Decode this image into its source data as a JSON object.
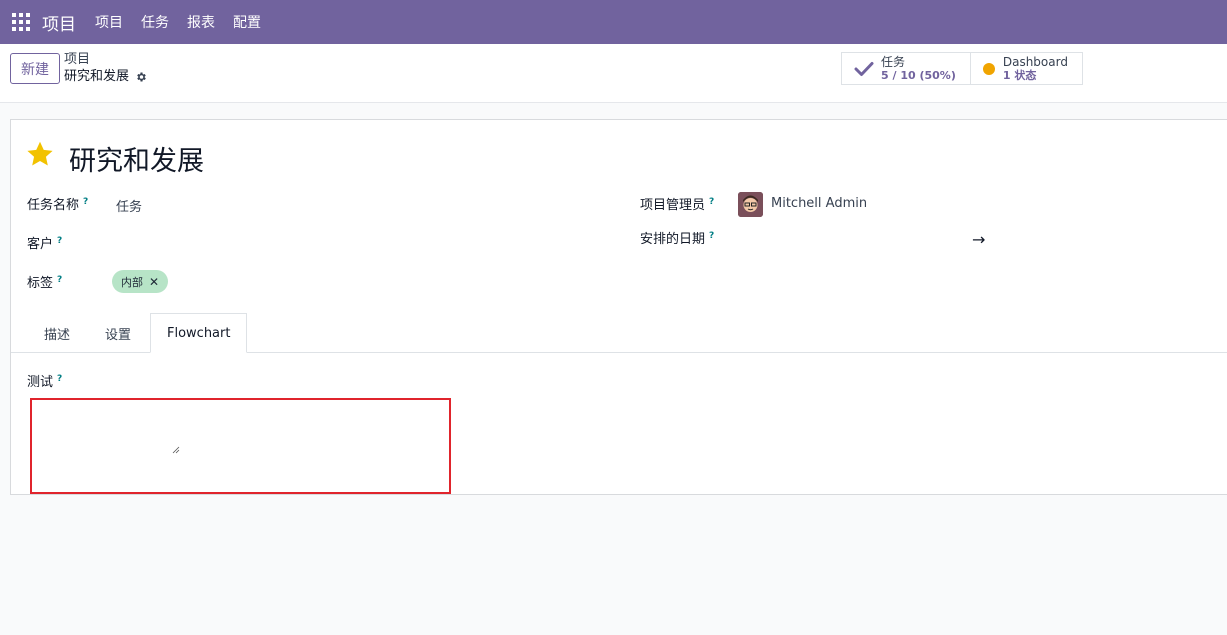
{
  "navbar": {
    "brand": "项目",
    "menu": [
      "项目",
      "任务",
      "报表",
      "配置"
    ]
  },
  "control_panel": {
    "new_label": "新建",
    "breadcrumb_parent": "项目",
    "breadcrumb_current": "研究和发展",
    "smart_buttons": {
      "tasks": {
        "title": "任务",
        "value": "5 / 10 (50%)"
      },
      "dashboard": {
        "title": "Dashboard",
        "value": "1 状态"
      }
    }
  },
  "form": {
    "title": "研究和发展",
    "fields": {
      "task_name": {
        "label": "任务名称",
        "help": "?",
        "value": "任务"
      },
      "customer": {
        "label": "客户",
        "help": "?"
      },
      "tags": {
        "label": "标签",
        "help": "?",
        "tag_value": "内部",
        "tag_remove": "✕"
      },
      "project_manager": {
        "label": "项目管理员",
        "help": "?",
        "value": "Mitchell Admin"
      },
      "planned_date": {
        "label": "安排的日期",
        "help": "?",
        "arrow": "→"
      }
    },
    "tabs": [
      "描述",
      "设置",
      "Flowchart"
    ],
    "active_tab": "Flowchart",
    "test_field": {
      "label": "测试",
      "help": "?"
    }
  },
  "colors": {
    "navbar": "#71639e",
    "highlight_border": "#e0242c",
    "tag_bg": "#b7e4c7",
    "star": "#f2c200"
  }
}
